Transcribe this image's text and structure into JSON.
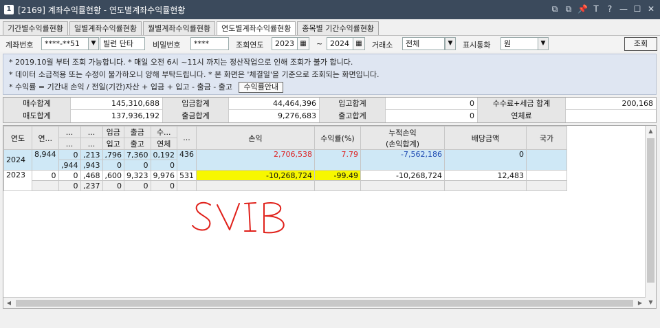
{
  "window": {
    "icon_text": "1",
    "title": "[2169] 계좌수익률현황 - 연도별계좌수익률현황",
    "buttons": [
      "⧉",
      "⧉",
      "📌",
      "T",
      "?",
      "—",
      "☐",
      "✕"
    ]
  },
  "tabs": [
    {
      "label": "기간별수익률현황",
      "active": false
    },
    {
      "label": "일별계좌수익률현황",
      "active": false
    },
    {
      "label": "월별계좌수익률현황",
      "active": false
    },
    {
      "label": "연도별계좌수익률현황",
      "active": true
    },
    {
      "label": "종목별 기간수익률현황",
      "active": false
    }
  ],
  "search": {
    "account_label": "계좌번호",
    "account_value": "****-**51",
    "account_name": "빌런 단타",
    "password_label": "비밀번호",
    "password_value": "****",
    "year_label": "조회연도",
    "year_from": "2023",
    "tilde": "~",
    "year_to": "2024",
    "exchange_label": "거래소",
    "exchange_value": "전체",
    "currency_label": "표시통화",
    "currency_value": "원",
    "query_button": "조회"
  },
  "notice": {
    "line1": "* 2019.10월 부터 조회 가능합니다.    * 매일 오전 6시 ~11시 까지는 정산작업으로 인해 조회가 불가 합니다.",
    "line2": "* 데이터 소급적용 또는 수정이 불가하오니 양해 부탁드립니다.    * 본 화면은 '체결일'을 기준으로 조회되는 화면입니다.",
    "line3": "* 수익률 = 기간내 손익 / 전일(기간)자산 + 입금 + 입고 - 출금 - 출고",
    "guide_button": "수익률안내"
  },
  "summary": {
    "buy_total_label": "매수합계",
    "buy_total": "145,310,688",
    "deposit_total_label": "입금합계",
    "deposit_total": "44,464,396",
    "in_total_label": "입고합계",
    "in_total": "0",
    "fee_tax_label": "수수료+세금 합계",
    "fee_tax": "200,168",
    "sell_total_label": "매도합계",
    "sell_total": "137,936,192",
    "withdraw_total_label": "출금합계",
    "withdraw_total": "9,276,683",
    "out_total_label": "출고합계",
    "out_total": "0",
    "overdue_label": "연체료",
    "overdue": ""
  },
  "grid": {
    "headers": {
      "year": "연도",
      "c1": "연...",
      "c2a": "...",
      "c2b": "...",
      "c3a": "...",
      "c3b": "...",
      "c4a": "입금",
      "c4b": "입고",
      "c5a": "출금",
      "c5b": "출고",
      "c6a": "수...",
      "c6b": "연체",
      "c7": "...",
      "pnl": "손익",
      "rate": "수익률(%)",
      "cum": "누적손익",
      "cum_sub": "(손익합계)",
      "dividend": "배당금액",
      "country": "국가"
    },
    "rows": [
      {
        "year": "2024",
        "c1": "8,944",
        "c2a": "0",
        "c2b": ",944",
        "c3a": ",213",
        "c3b": ",943",
        "c4a": ",796",
        "c4b": "0",
        "c5a": "7,360",
        "c5b": "0",
        "c6a": "0,192",
        "c6b": "0",
        "c7": "436",
        "pnl": "2,706,538",
        "rate": "7.79",
        "cum": "-7,562,186",
        "dividend": "0",
        "country": ""
      },
      {
        "year": "2023",
        "c1": "0",
        "c2a": "0",
        "c2b": "0",
        "c3a": ",468",
        "c3b": ",237",
        "c4a": ",600",
        "c4b": "0",
        "c5a": "9,323",
        "c5b": "0",
        "c6a": "9,976",
        "c6b": "0",
        "c7": "531",
        "pnl": "-10,268,724",
        "rate": "-99.49",
        "cum": "-10,268,724",
        "dividend": "12,483",
        "country": ""
      }
    ]
  },
  "annotation": {
    "handwritten_text": "SVIB",
    "color": "#e0201a"
  }
}
